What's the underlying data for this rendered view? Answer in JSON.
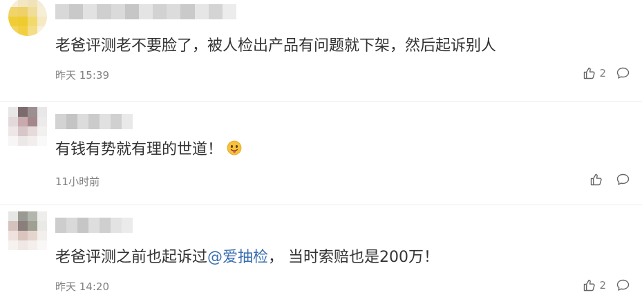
{
  "comments": [
    {
      "text": "老爸评测老不要脸了，被人检出产品有问题就下架，然后起诉别人",
      "time": "昨天 15:39",
      "likes": "2",
      "like_icon": "thumbs-up-icon",
      "reply_icon": "comment-bubble-icon"
    },
    {
      "text": "有钱有势就有理的世道！",
      "emoji": "tongue-out-emoji",
      "time": "11小时前",
      "likes": "",
      "like_icon": "thumbs-up-icon",
      "reply_icon": "comment-bubble-icon"
    },
    {
      "text_before": "老爸评测之前也起诉过",
      "mention": "@爱抽检",
      "text_after": "， 当时索赔也是200万！",
      "time": "昨天 14:20",
      "likes": "2",
      "like_icon": "thumbs-up-icon",
      "reply_icon": "comment-bubble-icon"
    }
  ],
  "colors": {
    "text": "#333333",
    "meta": "#808080",
    "mention": "#3a6fb0",
    "divider": "#eeeeee"
  }
}
